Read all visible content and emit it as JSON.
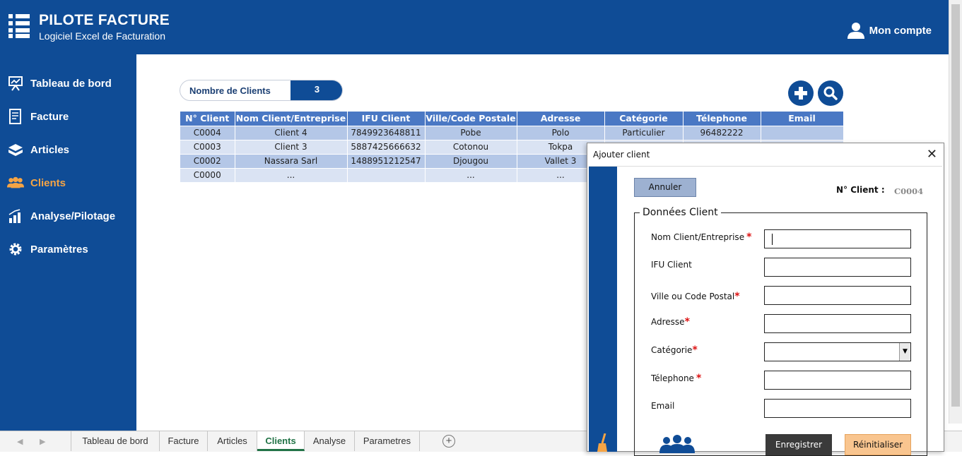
{
  "app": {
    "title": "PILOTE FACTURE",
    "subtitle": "Logiciel Excel de Facturation",
    "account_label": "Mon compte"
  },
  "sidebar": {
    "items": [
      {
        "label": "Tableau de bord",
        "icon": "presentation-chart-icon"
      },
      {
        "label": "Facture",
        "icon": "invoice-icon"
      },
      {
        "label": "Articles",
        "icon": "boxes-icon"
      },
      {
        "label": "Clients",
        "icon": "users-icon",
        "active": true
      },
      {
        "label": "Analyse/Pilotage",
        "icon": "bar-chart-icon"
      },
      {
        "label": "Paramètres",
        "icon": "gear-icon"
      }
    ]
  },
  "summary": {
    "count_label": "Nombre de Clients",
    "count_value": "3"
  },
  "table": {
    "headers": [
      "N° Client",
      "Nom Client/Entreprise",
      "IFU Client",
      "Ville/Code Postale",
      "Adresse",
      "Catégorie",
      "Télephone",
      "Email"
    ],
    "rows": [
      [
        "C0004",
        "Client 4",
        "7849923648811",
        "Pobe",
        "Polo",
        "Particulier",
        "96482222",
        ""
      ],
      [
        "C0003",
        "Client 3",
        "5887425666632",
        "Cotonou",
        "Tokpa",
        "",
        "",
        ""
      ],
      [
        "C0002",
        "Nassara Sarl",
        "1488951212547",
        "Djougou",
        "Vallet 3",
        "",
        "",
        ""
      ],
      [
        "C0000",
        "...",
        "",
        "...",
        "...",
        "",
        "",
        ""
      ]
    ]
  },
  "dialog": {
    "title": "Ajouter client",
    "cancel_label": "Annuler",
    "num_label": "N° Client :",
    "num_value": "C0004",
    "group_title": "Données Client",
    "fields": [
      {
        "label": "Nom Client/Entreprise",
        "required": true
      },
      {
        "label": "IFU Client",
        "required": false
      },
      {
        "label": "Ville ou Code Postal",
        "required": true
      },
      {
        "label": "Adresse",
        "required": true
      },
      {
        "label": "Catégorie",
        "required": true
      },
      {
        "label": "Télephone",
        "required": true
      },
      {
        "label": "Email",
        "required": false
      }
    ],
    "required_mark": "*",
    "save_label": "Enregistrer",
    "reset_label": "Réinitialiser"
  },
  "sheet_tabs": [
    "Tableau de bord",
    "Facture",
    "Articles",
    "Clients",
    "Analyse",
    "Parametres"
  ],
  "active_sheet": "Clients",
  "colors": {
    "brand_blue": "#0f4c96",
    "active_orange": "#f5a445",
    "table_header": "#4a78c4",
    "row_dark": "#b4c7e7",
    "row_light": "#dae3f3"
  }
}
